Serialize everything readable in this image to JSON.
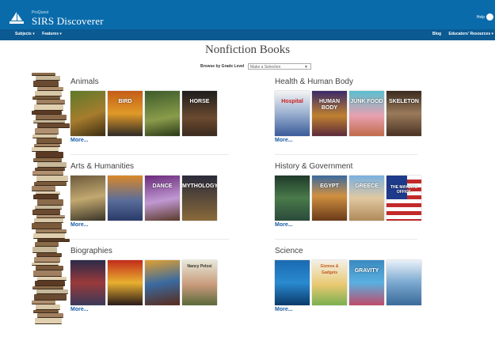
{
  "header": {
    "brand_small": "ProQuest",
    "brand": "SIRS Discoverer",
    "help": "Help"
  },
  "nav": {
    "subjects": "Subjects ▾",
    "features": "Features ▾",
    "blog": "Blog",
    "educators": "Educators' Resources ▾"
  },
  "page_title": "Nonfiction Books",
  "browse": {
    "label": "Browse by Grade Level",
    "selected": "Make a Selection"
  },
  "sections": [
    {
      "title": "Animals",
      "more": "More...",
      "covers": [
        "",
        "BIRD",
        "",
        "HORSE"
      ]
    },
    {
      "title": "Arts & Humanities",
      "more": "More...",
      "covers": [
        "",
        "",
        "DANCE",
        "MYTHOLOGY"
      ]
    },
    {
      "title": "Biographies",
      "more": "More...",
      "covers": [
        "",
        "",
        "",
        "Nancy Pelosi"
      ]
    },
    {
      "title": "Health & Human Body",
      "more": "More...",
      "covers": [
        "Hospital",
        "HUMAN BODY",
        "JUNK FOOD",
        "SKELETON"
      ]
    },
    {
      "title": "History & Government",
      "more": "More...",
      "covers": [
        "",
        "EGYPT",
        "GREECE",
        "THE MAYOR'S OFFICE"
      ]
    },
    {
      "title": "Science",
      "more": "More...",
      "covers": [
        "",
        "Gizmos & Gadgets",
        "GRAVITY",
        ""
      ]
    }
  ],
  "colors": {
    "topbar": "#0a6bab",
    "navbar": "#0b5a92",
    "link": "#1a5ea8"
  }
}
